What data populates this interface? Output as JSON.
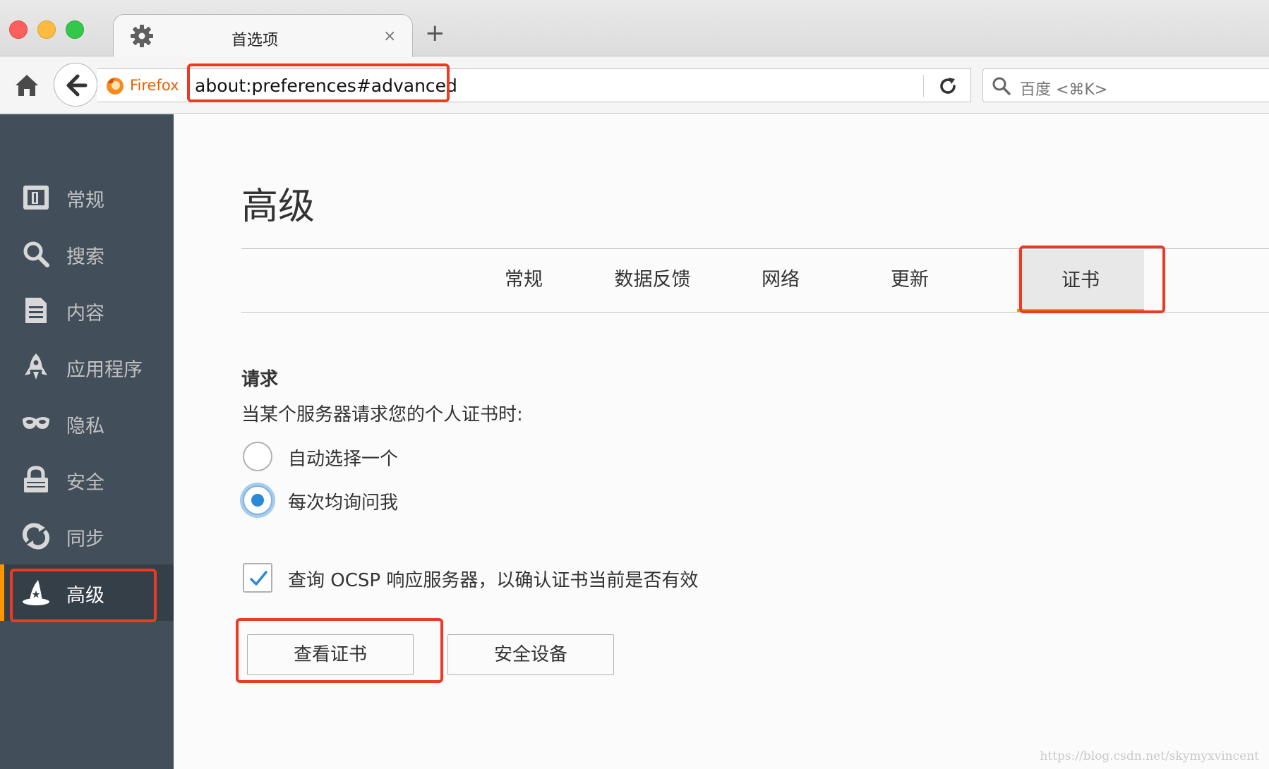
{
  "window": {
    "tab": {
      "title": "首选项",
      "close_glyph": "×",
      "icon": "gear-icon"
    },
    "new_tab_glyph": "+"
  },
  "navbar": {
    "identity_label": "Firefox",
    "url": "about:preferences#advanced",
    "search_placeholder": "百度 <⌘K>"
  },
  "sidebar": {
    "items": [
      {
        "label": "常规",
        "icon": "general-icon"
      },
      {
        "label": "搜索",
        "icon": "search-icon"
      },
      {
        "label": "内容",
        "icon": "content-icon"
      },
      {
        "label": "应用程序",
        "icon": "applications-icon"
      },
      {
        "label": "隐私",
        "icon": "privacy-mask-icon"
      },
      {
        "label": "安全",
        "icon": "lock-icon"
      },
      {
        "label": "同步",
        "icon": "sync-icon"
      },
      {
        "label": "高级",
        "icon": "wizard-hat-icon",
        "selected": true
      }
    ]
  },
  "main": {
    "title": "高级",
    "tabs": [
      {
        "label": "常规"
      },
      {
        "label": "数据反馈"
      },
      {
        "label": "网络"
      },
      {
        "label": "更新"
      },
      {
        "label": "证书",
        "selected": true
      }
    ],
    "section": {
      "heading": "请求",
      "description": "当某个服务器请求您的个人证书时:",
      "options": [
        {
          "label": "自动选择一个",
          "checked": false
        },
        {
          "label": "每次均询问我",
          "checked": true
        }
      ],
      "ocsp": {
        "label": "查询 OCSP 响应服务器，以确认证书当前是否有效",
        "checked": true
      },
      "buttons": {
        "view_certs": "查看证书",
        "security_devices": "安全设备"
      }
    }
  },
  "watermark": "https://blog.csdn.net/skymyxvincent",
  "colors": {
    "accent": "#ff9500",
    "highlight": "#ee3a23",
    "sidebar_bg": "#424f5a",
    "radio_blue": "#2b8ad8"
  }
}
